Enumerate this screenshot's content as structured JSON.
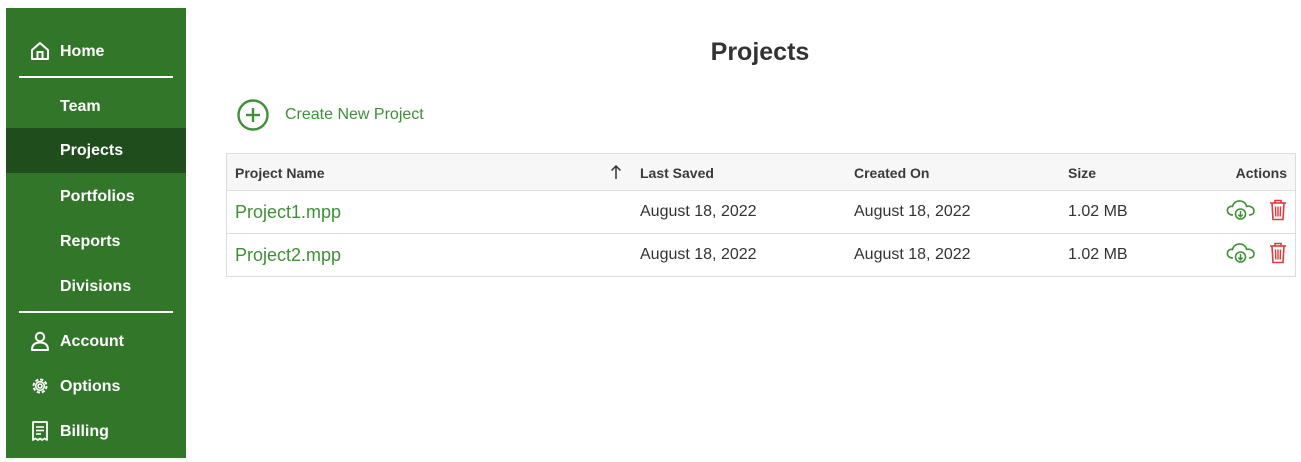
{
  "sidebar": {
    "items": [
      {
        "label": "Home",
        "icon": "home-icon"
      },
      {
        "label": "Team"
      },
      {
        "label": "Projects",
        "active": true
      },
      {
        "label": "Portfolios"
      },
      {
        "label": "Reports"
      },
      {
        "label": "Divisions"
      },
      {
        "label": "Account",
        "icon": "user-icon"
      },
      {
        "label": "Options",
        "icon": "gear-icon"
      },
      {
        "label": "Billing",
        "icon": "receipt-icon"
      }
    ]
  },
  "page": {
    "title": "Projects",
    "create_label": "Create New Project"
  },
  "table": {
    "columns": [
      "Project Name",
      "Last Saved",
      "Created On",
      "Size",
      "Actions"
    ],
    "sort_indicator": "ascending",
    "rows": [
      {
        "name": "Project1.mpp",
        "last_saved": "August 18, 2022",
        "created_on": "August 18, 2022",
        "size": "1.02 MB"
      },
      {
        "name": "Project2.mpp",
        "last_saved": "August 18, 2022",
        "created_on": "August 18, 2022",
        "size": "1.02 MB"
      }
    ]
  },
  "colors": {
    "sidebar_bg": "#317629",
    "sidebar_active": "#1f4d1c",
    "accent_green": "#3f8f37",
    "delete_red": "#e03a3a"
  }
}
